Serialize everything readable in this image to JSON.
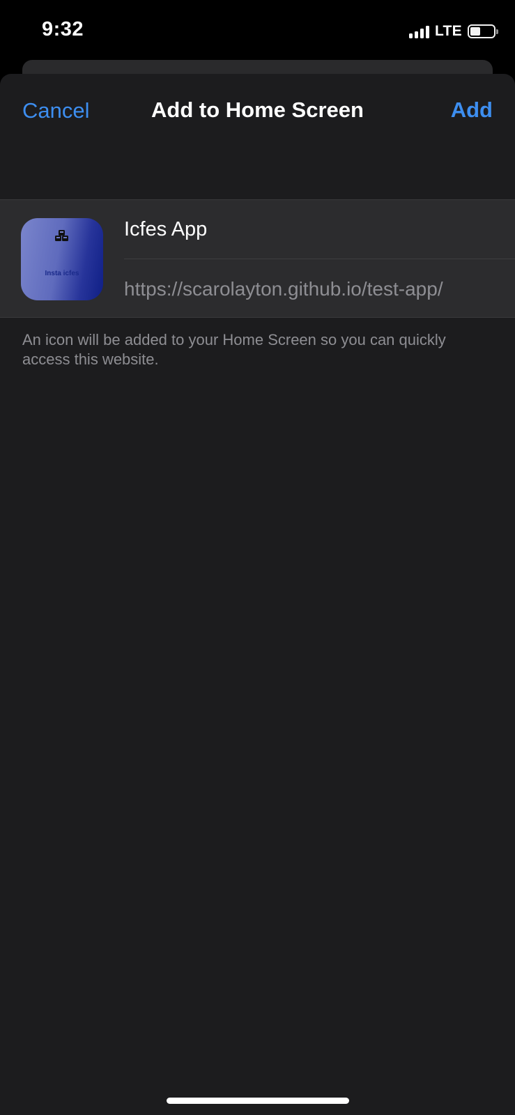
{
  "status_bar": {
    "time": "9:32",
    "network": "LTE",
    "signal_bars": 4,
    "battery_level": 0.45
  },
  "sheet": {
    "title": "Add to Home Screen",
    "cancel_label": "Cancel",
    "add_label": "Add",
    "accent_color": "#3d8ef0"
  },
  "form": {
    "app_name": "Icfes App",
    "url": "https://scarolayton.github.io/test-app/",
    "icon": {
      "label": "Insta icfes",
      "glyph": "cubes-icon"
    }
  },
  "footnote": "An icon will be added to your Home Screen so you can quickly access this website."
}
